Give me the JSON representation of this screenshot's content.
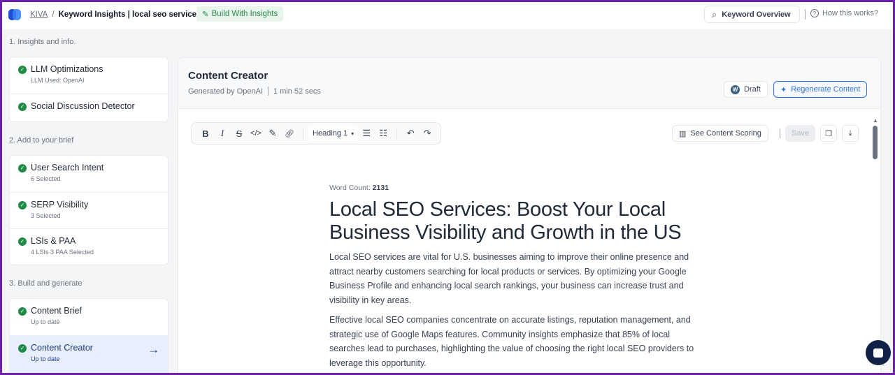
{
  "header": {
    "breadcrumb_root": "KIVA",
    "breadcrumb_sep": "/",
    "breadcrumb_current": "Keyword Insights | local seo services",
    "build_label": "Build With Insights",
    "keyword_overview": "Keyword Overview",
    "how_it_works": "How this works?"
  },
  "sidebar": {
    "sections": [
      {
        "label": "1. Insights and info.",
        "items": [
          {
            "title": "LLM Optimizations",
            "sub": "LLM Used: OpenAI"
          },
          {
            "title": "Social Discussion Detector",
            "sub": ""
          }
        ]
      },
      {
        "label": "2. Add to your brief",
        "items": [
          {
            "title": "User Search Intent",
            "sub": "6 Selected"
          },
          {
            "title": "SERP Visibility",
            "sub": "3 Selected"
          },
          {
            "title": "LSIs & PAA",
            "sub": "4 LSIs 3 PAA Selected"
          }
        ]
      },
      {
        "label": "3. Build and generate",
        "items": [
          {
            "title": "Content Brief",
            "sub": "Up to date"
          },
          {
            "title": "Content Creator",
            "sub": "Up to date",
            "active": true
          }
        ]
      }
    ]
  },
  "panel": {
    "title": "Content Creator",
    "generated_by": "Generated by OpenAI",
    "duration": "1 min 52 secs",
    "draft_label": "Draft",
    "regenerate_label": "Regenerate Content"
  },
  "toolbar": {
    "heading_select": "Heading 1",
    "see_scoring": "See Content Scoring",
    "save": "Save"
  },
  "article": {
    "word_count_label": "Word Count:",
    "word_count": "2131",
    "title": "Local SEO Services: Boost Your Local Business Visibility and Growth in the US",
    "paragraphs": [
      "Local SEO services are vital for U.S. businesses aiming to improve their online presence and attract nearby customers searching for local products or services. By optimizing your Google Business Profile and enhancing local search rankings, your business can increase trust and visibility in key areas.",
      "Effective local SEO companies concentrate on accurate listings, reputation management, and strategic use of Google Maps features. Community insights emphasize that 85% of local searches lead to purchases, highlighting the value of choosing the right local SEO providers to leverage this opportunity."
    ]
  },
  "colors": {
    "frame": "#6b21a8",
    "accent": "#2f6fe0",
    "success": "#1f8a45",
    "active_bg": "#e8effc"
  }
}
